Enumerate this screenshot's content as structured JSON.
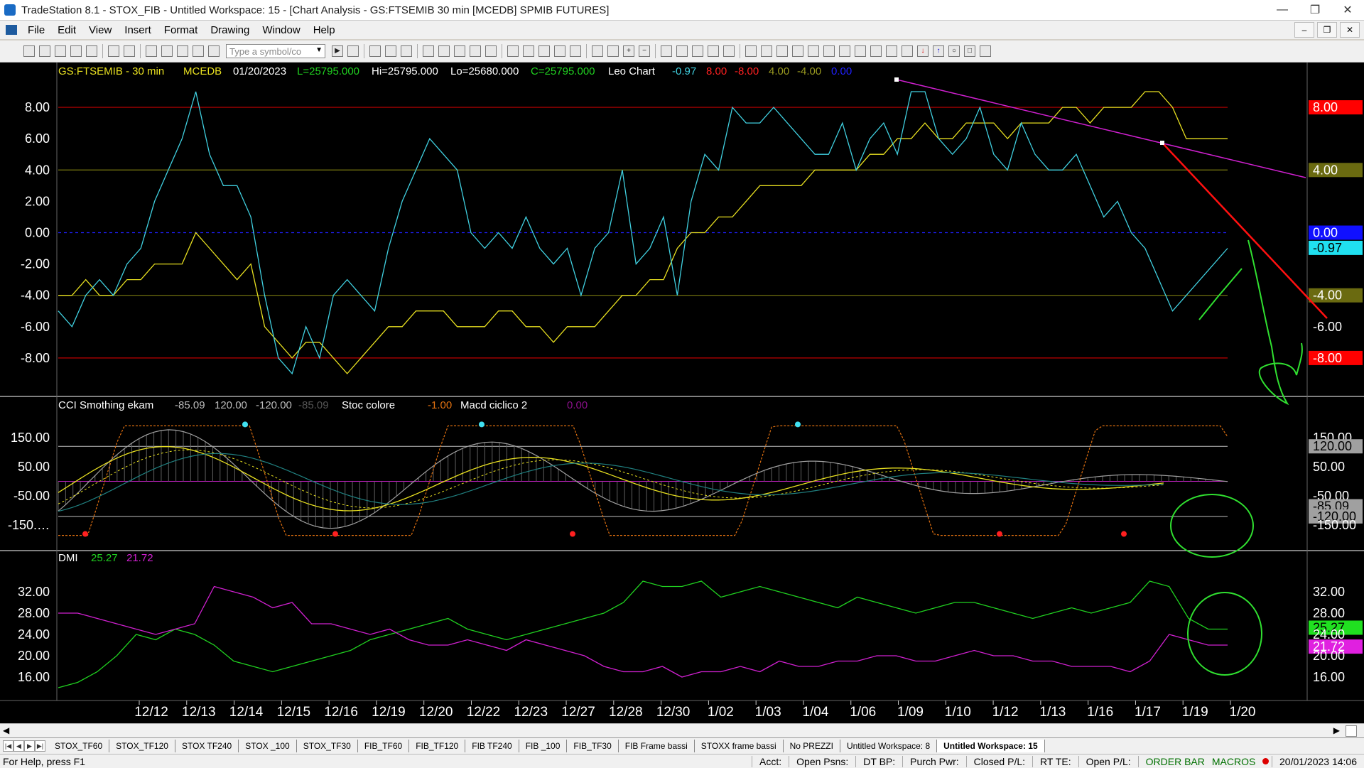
{
  "window": {
    "title": "TradeStation 8.1 - STOX_FIB - Untitled Workspace: 15 - [Chart Analysis - GS:FTSEMIB  30 min  [MCEDB] SPMIB FUTURES]",
    "minimize": "—",
    "maximize": "❐",
    "close": "✕"
  },
  "menu": {
    "items": [
      "File",
      "Edit",
      "View",
      "Insert",
      "Format",
      "Drawing",
      "Window",
      "Help"
    ],
    "mdi_min": "–",
    "mdi_restore": "❐",
    "mdi_close": "✕"
  },
  "toolbar": {
    "symbol_placeholder": "Type a symbol/co"
  },
  "chart": {
    "header": {
      "symbol": "GS:FTSEMIB - 30 min",
      "exchange": "MCEDB",
      "date": "01/20/2023",
      "last": "L=25795.000",
      "high": "Hi=25795.000",
      "low": "Lo=25680.000",
      "close": "C=25795.000",
      "study": "Leo Chart",
      "v1": "-0.97",
      "v2": "8.00",
      "v3": "-8.00",
      "v4": "4.00",
      "v5": "-4.00",
      "v6": "0.00"
    },
    "pane2": {
      "name": "CCI Smothing ekam",
      "v1": "-85.09",
      "v2": "120.00",
      "v3": "-120.00",
      "v4": "-85.09",
      "stoc": "Stoc colore",
      "stoc_val": "-1.00",
      "macd": "Macd ciclico 2",
      "macd_val": "0.00"
    },
    "pane3": {
      "name": "DMI",
      "plus": "25.27",
      "minus": "21.72"
    },
    "colors": {
      "cyan": "#40d0e0",
      "yellow": "#e8e020",
      "red_level": "#c00000",
      "olive_level": "#7a7a10",
      "magenta": "#d020d0",
      "green": "#20d020",
      "drawn_red": "#ff1010",
      "drawn_green": "#30e030"
    }
  },
  "chart_data": [
    {
      "type": "line",
      "title": "GS:FTSEMIB - 30 min",
      "ylim": [
        -10,
        9.5
      ],
      "yticks": [
        "8.00",
        "6.00",
        "4.00",
        "2.00",
        "0.00",
        "-2.00",
        "-4.00",
        "-6.00",
        "-8.00"
      ],
      "x_tick_labels": [
        "12/12",
        "12/13",
        "12/14",
        "12/15",
        "12/16",
        "12/19",
        "12/20",
        "12/22",
        "12/23",
        "12/27",
        "12/28",
        "12/30",
        "1/02",
        "1/03",
        "1/04",
        "1/06",
        "1/09",
        "1/10",
        "1/12",
        "1/13",
        "1/16",
        "1/17",
        "1/19",
        "1/20"
      ],
      "levels": [
        8,
        4,
        0,
        -4,
        -8
      ],
      "right_labels": [
        "8.00",
        "4.00",
        "0.00",
        "-0.97",
        "-4.00",
        "-6.00",
        "-8.00"
      ],
      "series": [
        {
          "name": "cyan",
          "values": [
            -5,
            -6,
            -4,
            -3,
            -4,
            -2,
            -1,
            2,
            4,
            6,
            9,
            5,
            3,
            3,
            1,
            -4,
            -8,
            -9,
            -6,
            -8,
            -4,
            -3,
            -4,
            -5,
            -1,
            2,
            4,
            6,
            5,
            4,
            0,
            -1,
            0,
            -1,
            1,
            -1,
            -2,
            -1,
            -4,
            -1,
            0,
            4,
            -2,
            -1,
            1,
            -4,
            2,
            5,
            4,
            8,
            7,
            7,
            8,
            7,
            6,
            5,
            5,
            7,
            4,
            6,
            7,
            5,
            9,
            9,
            6,
            5,
            6,
            8,
            5,
            4,
            7,
            5,
            4,
            4,
            5,
            3,
            1,
            2,
            0,
            -1,
            -3,
            -5,
            -4,
            -3,
            -2,
            -1
          ],
          "x_start": 0
        },
        {
          "name": "yellow",
          "values": [
            -4,
            -4,
            -3,
            -4,
            -4,
            -3,
            -3,
            -2,
            -2,
            -2,
            0,
            -1,
            -2,
            -3,
            -2,
            -6,
            -7,
            -8,
            -7,
            -7,
            -8,
            -9,
            -8,
            -7,
            -6,
            -6,
            -5,
            -5,
            -5,
            -6,
            -6,
            -6,
            -5,
            -5,
            -6,
            -6,
            -7,
            -6,
            -6,
            -6,
            -5,
            -4,
            -4,
            -3,
            -3,
            -1,
            0,
            0,
            1,
            1,
            2,
            3,
            3,
            3,
            3,
            4,
            4,
            4,
            4,
            5,
            5,
            6,
            6,
            7,
            6,
            6,
            7,
            7,
            7,
            6,
            7,
            7,
            7,
            8,
            8,
            7,
            8,
            8,
            8,
            9,
            9,
            8,
            6,
            6,
            6,
            6
          ],
          "x_start": 0
        }
      ]
    },
    {
      "type": "line",
      "title": "CCI Smothing ekam",
      "ylim": [
        -220,
        230
      ],
      "yticks": [
        "150.00",
        "50.00",
        "-50.00",
        "-150.…"
      ],
      "right_labels": [
        "150.00",
        "120.00",
        "50.00",
        "-50.00",
        "-85.09",
        "-120.00",
        "-150.00"
      ],
      "levels": [
        120,
        0,
        -120
      ]
    },
    {
      "type": "line",
      "title": "DMI",
      "ylim": [
        12,
        38
      ],
      "yticks": [
        "32.00",
        "28.00",
        "24.00",
        "20.00",
        "16.00"
      ],
      "right_labels": [
        "32.00",
        "28.00",
        "25.27",
        "24.00",
        "21.72",
        "20.00",
        "16.00"
      ],
      "series": [
        {
          "name": "25.27",
          "values": [
            14,
            15,
            17,
            20,
            24,
            23,
            25,
            24,
            22,
            19,
            18,
            17,
            18,
            19,
            20,
            21,
            23,
            24,
            25,
            26,
            27,
            25,
            24,
            23,
            24,
            25,
            26,
            27,
            28,
            30,
            34,
            33,
            33,
            34,
            31,
            32,
            33,
            32,
            31,
            30,
            29,
            31,
            30,
            29,
            28,
            29,
            30,
            30,
            29,
            28,
            27,
            28,
            29,
            28,
            29,
            30,
            34,
            33,
            27,
            25,
            25
          ]
        },
        {
          "name": "21.72",
          "values": [
            28,
            28,
            27,
            26,
            25,
            24,
            25,
            26,
            33,
            32,
            31,
            29,
            30,
            26,
            26,
            25,
            24,
            25,
            23,
            22,
            22,
            23,
            22,
            21,
            23,
            22,
            21,
            20,
            18,
            17,
            17,
            18,
            16,
            17,
            17,
            18,
            17,
            19,
            18,
            18,
            19,
            19,
            20,
            20,
            19,
            19,
            20,
            21,
            20,
            20,
            19,
            19,
            18,
            18,
            18,
            17,
            19,
            24,
            23,
            22,
            22
          ]
        }
      ]
    }
  ],
  "tabs": [
    "STOX_TF60",
    "STOX_TF120",
    "STOX TF240",
    "STOX _100",
    "STOX_TF30",
    "FIB_TF60",
    "FIB_TF120",
    "FIB TF240",
    "FIB _100",
    "FIB_TF30",
    "FIB Frame bassi",
    "STOXX frame bassi",
    "No PREZZI",
    "Untitled Workspace: 8",
    "Untitled Workspace: 15"
  ],
  "statusbar": {
    "help": "For Help, press F1",
    "acct": "Acct:",
    "open_psns": "Open Psns:",
    "dt_bp": "DT BP:",
    "purch_pwr": "Purch Pwr:",
    "closed_pl": "Closed P/L:",
    "rt_te": "RT TE:",
    "open_pl": "Open P/L:",
    "order_bar": "ORDER BAR",
    "macros": "MACROS",
    "datetime": "20/01/2023 14:06"
  }
}
